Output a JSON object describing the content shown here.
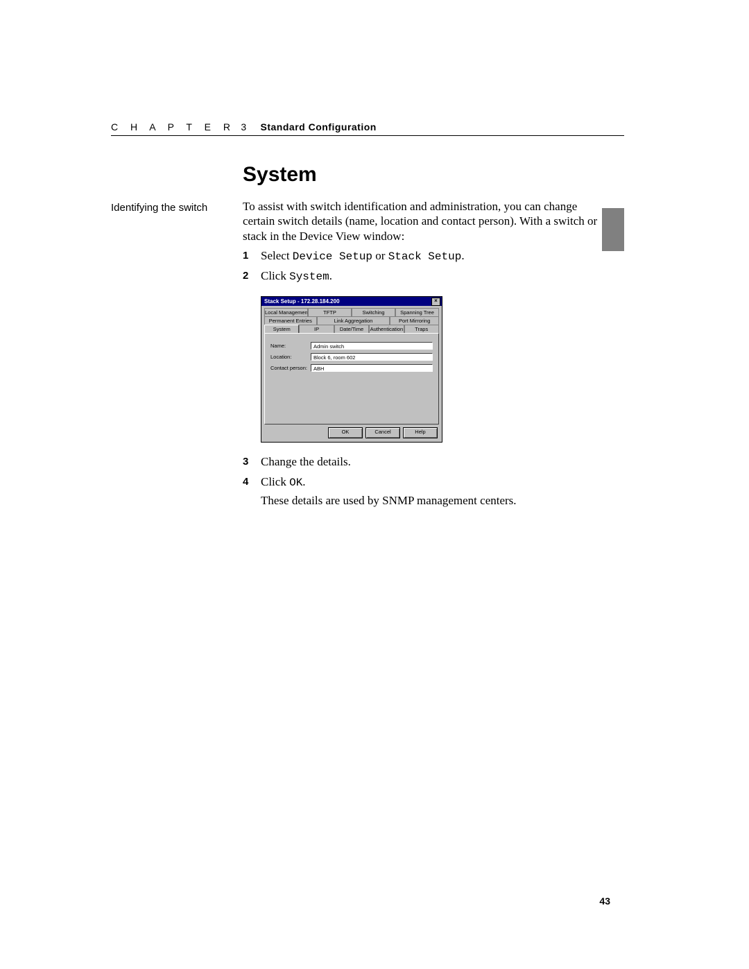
{
  "header": {
    "chapter_word": "C H A P T E R",
    "chapter_number": "3",
    "chapter_title": "Standard Configuration"
  },
  "section_title": "System",
  "margin_note": "Identifying the switch",
  "intro": "To assist with switch identification and administration, you can change certain switch details (name, location and contact person). With a switch or stack in the Device View window:",
  "steps": {
    "s1_pre": "Select ",
    "s1_code1": "Device Setup",
    "s1_mid": " or ",
    "s1_code2": "Stack Setup",
    "s1_post": ".",
    "s2_pre": "Click ",
    "s2_code": "System",
    "s2_post": ".",
    "s3": "Change the details.",
    "s4_pre": "Click ",
    "s4_code": "OK",
    "s4_post": "."
  },
  "after_note": "These details are used by SNMP management centers.",
  "dialog": {
    "title": "Stack Setup - 172.28.184.200",
    "close_glyph": "×",
    "tabs_row1": [
      "Local Management",
      "TFTP",
      "Switching",
      "Spanning Tree"
    ],
    "tabs_row2": [
      "Permanent Entries",
      "Link Aggregation",
      "Port Mirroring"
    ],
    "tabs_row3": [
      "System",
      "IP",
      "Date/Time",
      "Authentication",
      "Traps"
    ],
    "active_tab": "System",
    "fields": {
      "name_label": "Name:",
      "name_value": "Admin switch",
      "location_label": "Location:",
      "location_value": "Block 6, room 602",
      "contact_label": "Contact person:",
      "contact_value": "ABH"
    },
    "buttons": {
      "ok": "OK",
      "cancel": "Cancel",
      "help": "Help"
    }
  },
  "page_number": "43"
}
